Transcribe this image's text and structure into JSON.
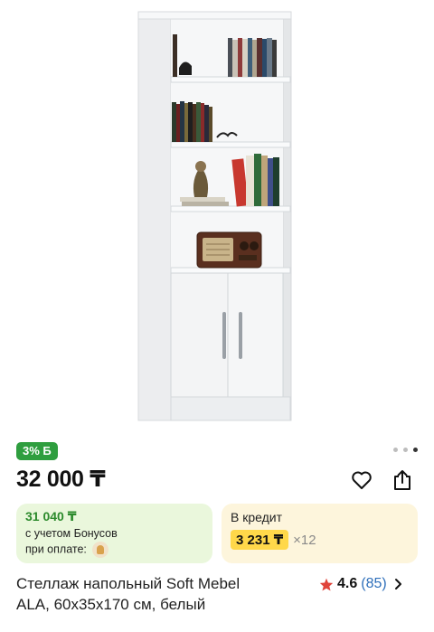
{
  "product": {
    "bonus_badge": "3% Б",
    "price": "32 000 ₸",
    "title_line1": "Стеллаж напольный Soft Mebel",
    "title_line2": "ALA, 60x35x170 см, белый"
  },
  "gallery": {
    "dots": 3,
    "active_index": 2
  },
  "bonus_card": {
    "price": "31 040 ₸",
    "note_line1": "с учетом Бонусов",
    "note_line2": "при оплате:"
  },
  "credit_card": {
    "label": "В кредит",
    "amount": "3 231 ₸",
    "term": "×12"
  },
  "rating": {
    "value": "4.6",
    "count": "(85)"
  },
  "colors": {
    "badge_green": "#2f9e3f",
    "bonus_bg": "#eaf7dc",
    "credit_bg": "#fdf5dc",
    "credit_highlight": "#ffd84a",
    "star": "#e0433a",
    "link_blue": "#2e6fba"
  },
  "icons": {
    "heart": "heart-icon",
    "share": "share-icon",
    "star": "star-icon",
    "chevron": "chevron-right-icon",
    "coin": "bonus-coin-icon"
  }
}
